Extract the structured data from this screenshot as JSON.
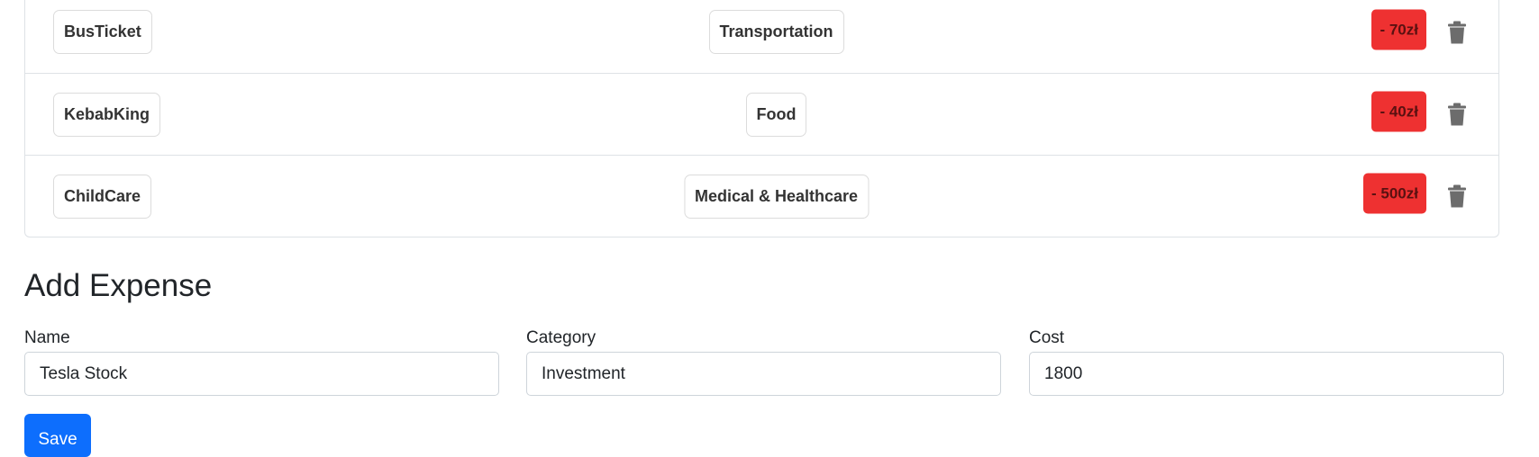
{
  "expenses": [
    {
      "name": "BusTicket",
      "category": "Transportation",
      "cost": "- 70zł"
    },
    {
      "name": "KebabKing",
      "category": "Food",
      "cost": "- 40zł"
    },
    {
      "name": "ChildCare",
      "category": "Medical & Healthcare",
      "cost": "- 500zł"
    }
  ],
  "form": {
    "heading": "Add Expense",
    "name_label": "Name",
    "name_value": "Tesla Stock",
    "category_label": "Category",
    "category_value": "Investment",
    "cost_label": "Cost",
    "cost_value": "1800",
    "save_label": "Save"
  },
  "icons": {
    "delete": "trash-icon"
  },
  "colors": {
    "cost_badge": "#ee3131",
    "primary": "#0d6efd"
  }
}
